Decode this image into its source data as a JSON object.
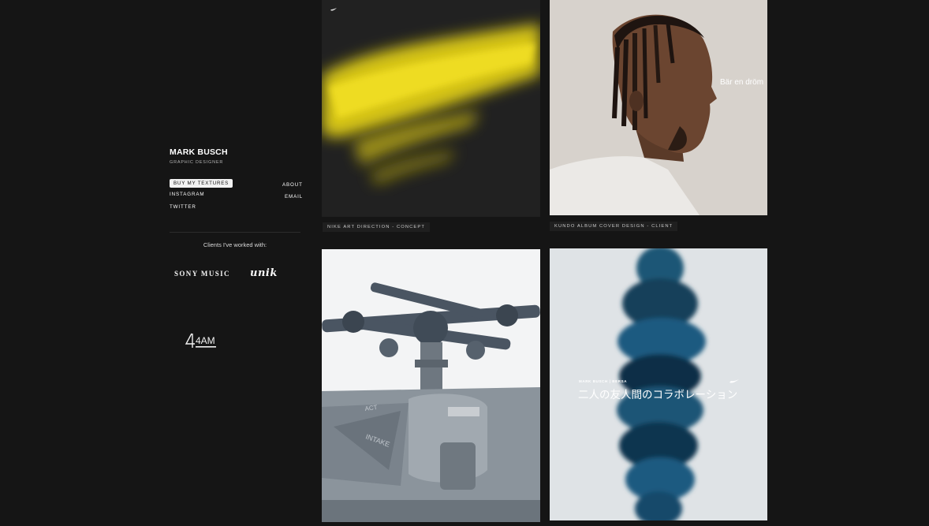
{
  "profile": {
    "name": "MARK BUSCH",
    "role": "GRAPHIC DESIGNER"
  },
  "nav": {
    "buy_textures": "BUY MY TEXTURES",
    "instagram": "INSTAGRAM",
    "twitter": "TWITTER",
    "about": "ABOUT",
    "email": "EMAIL"
  },
  "clients": {
    "heading": "Clients I've worked with:",
    "logos": {
      "sony": "SONY MUSIC",
      "unik": "UNIK",
      "fouram": "4AM"
    }
  },
  "projects": [
    {
      "caption": "NIKE ART DIRECTION - CONCEPT"
    },
    {
      "caption": "KUNDO ALBUM COVER DESIGN - CLIENT",
      "art_text": "Bär en dröm"
    },
    {
      "caption": ""
    },
    {
      "caption": "",
      "art_small": "MARK BUSCH | BERSA",
      "art_text": "二人の友人間のコラボレーション"
    }
  ],
  "colors": {
    "background": "#151515",
    "text": "#ffffff",
    "muted": "#b5b5b5",
    "caption_bg": "#1f1f1f",
    "accent_yellow": "#e2d21f",
    "accent_blue": "#1b5a80"
  }
}
